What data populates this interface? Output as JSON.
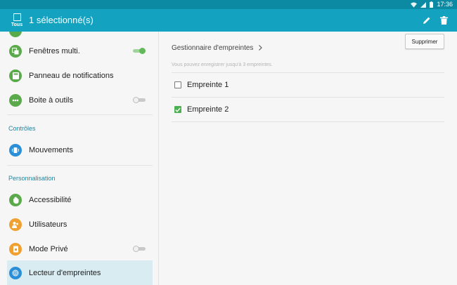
{
  "status_bar": {
    "time": "17:36",
    "icons": [
      "wifi-icon",
      "signal-icon",
      "battery-icon"
    ],
    "color": "#0d8aa3"
  },
  "action_bar": {
    "select_all_label": "Tous",
    "title": "1 sélectionné(s)",
    "icons": [
      "edit-icon",
      "trash-icon"
    ],
    "color": "#13a2c0"
  },
  "sidebar": {
    "items": [
      {
        "label": "Fenêtres multi.",
        "icon": "multi-window-icon",
        "icon_color": "#5aaa4b",
        "toggle": "on"
      },
      {
        "label": "Panneau de notifications",
        "icon": "notification-panel-icon",
        "icon_color": "#5aaa4b"
      },
      {
        "label": "Boite à outils",
        "icon": "toolbox-icon",
        "icon_color": "#5aaa4b",
        "toggle": "off"
      },
      {
        "label": "Mouvements",
        "icon": "motion-icon",
        "icon_color": "#2b8fd8"
      },
      {
        "label": "Accessibilité",
        "icon": "accessibility-hand-icon",
        "icon_color": "#5aaa4b"
      },
      {
        "label": "Utilisateurs",
        "icon": "users-icon",
        "icon_color": "#f0a030"
      },
      {
        "label": "Mode Privé",
        "icon": "private-mode-icon",
        "icon_color": "#f0a030",
        "toggle": "off"
      },
      {
        "label": "Lecteur d'empreintes",
        "icon": "fingerprint-icon",
        "icon_color": "#2b8fd8",
        "selected": true
      }
    ],
    "sections": {
      "controls": "Contrôles",
      "personalisation": "Personnalisation"
    },
    "selected_bg": "#d8ecf2",
    "section_color": "#1b86a3"
  },
  "main": {
    "delete_label": "Supprimer",
    "manager_link": "Gestionnaire d'empreintes",
    "info": "Vous pouvez enregistrer jusqu'à 3 empreintes.",
    "fingerprints": [
      {
        "label": "Empreinte 1",
        "checked": false
      },
      {
        "label": "Empreinte 2",
        "checked": true
      }
    ],
    "check_color": "#4caf50"
  }
}
